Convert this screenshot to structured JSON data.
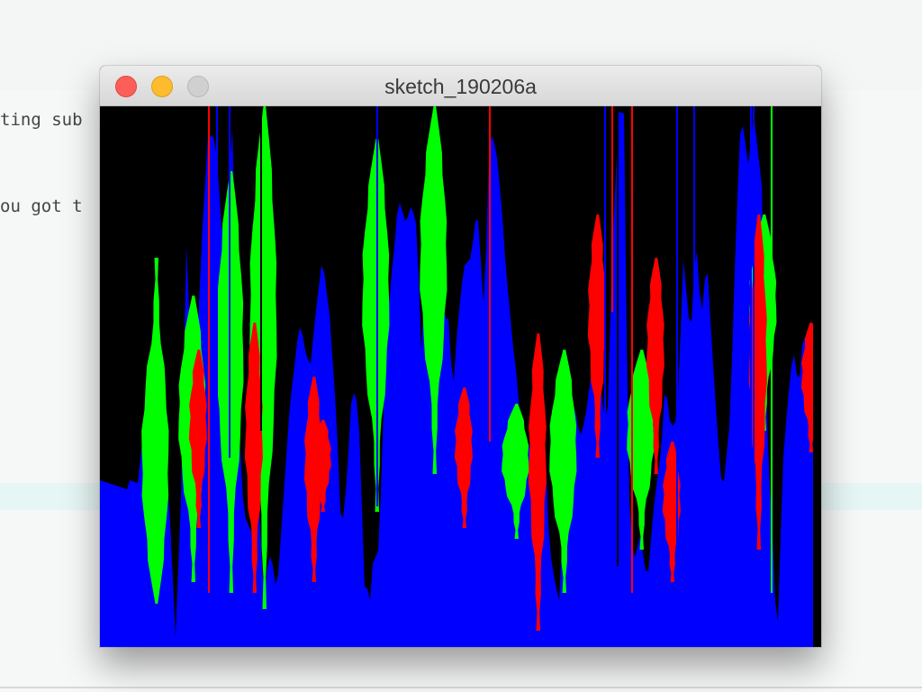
{
  "editor": {
    "lines": [
      {
        "text": "ting sub"
      },
      {
        "text": "ou got t"
      }
    ]
  },
  "window": {
    "title": "sketch_190206a",
    "buttons": {
      "close": "close-icon",
      "minimize": "minimize-icon",
      "zoom": "zoom-icon"
    }
  },
  "sketch": {
    "background": "#000000",
    "colors": {
      "blue": "#0000ff",
      "green": "#00ff00",
      "red": "#ff0000"
    },
    "segments": [
      [
        42,
        70,
        0
      ],
      [
        56,
        48,
        0
      ],
      [
        63,
        88,
        1
      ],
      [
        67,
        75,
        1
      ],
      [
        72,
        72,
        0
      ],
      [
        76,
        70,
        0
      ],
      [
        84,
        98,
        0
      ],
      [
        90,
        72,
        0
      ],
      [
        96,
        25,
        1
      ],
      [
        104,
        62,
        1
      ],
      [
        107,
        48,
        2
      ],
      [
        114,
        22,
        0
      ],
      [
        120,
        5,
        1
      ],
      [
        128,
        5,
        1
      ],
      [
        136,
        26,
        1
      ],
      [
        142,
        16,
        1
      ],
      [
        148,
        2,
        0
      ],
      [
        153,
        55,
        1
      ],
      [
        159,
        72,
        2
      ],
      [
        164,
        78,
        0
      ],
      [
        170,
        80,
        0
      ],
      [
        177,
        75,
        2
      ],
      [
        182,
        92,
        2
      ],
      [
        186,
        85,
        0
      ],
      [
        190,
        82,
        0
      ],
      [
        197,
        90,
        0
      ],
      [
        205,
        70,
        1
      ],
      [
        211,
        55,
        1
      ],
      [
        216,
        48,
        2
      ],
      [
        221,
        40,
        0
      ],
      [
        226,
        42,
        0
      ],
      [
        233,
        50,
        0
      ],
      [
        240,
        38,
        2
      ],
      [
        247,
        28,
        0
      ],
      [
        255,
        38,
        0
      ],
      [
        262,
        55,
        0
      ],
      [
        268,
        80,
        0
      ],
      [
        274,
        70,
        2
      ],
      [
        280,
        52,
        0
      ],
      [
        287,
        55,
        0
      ],
      [
        294,
        88,
        0
      ],
      [
        300,
        92,
        0
      ],
      [
        303,
        85,
        2
      ],
      [
        310,
        82,
        0
      ],
      [
        317,
        45,
        0
      ],
      [
        325,
        28,
        0
      ],
      [
        332,
        18,
        0
      ],
      [
        340,
        22,
        0
      ],
      [
        346,
        18,
        0
      ],
      [
        352,
        22,
        0
      ],
      [
        357,
        45,
        0
      ],
      [
        362,
        28,
        0
      ],
      [
        370,
        4,
        1
      ],
      [
        376,
        2,
        1
      ],
      [
        382,
        42,
        0
      ],
      [
        386,
        36,
        0
      ],
      [
        392,
        52,
        1
      ],
      [
        398,
        40,
        0
      ],
      [
        404,
        30,
        0
      ],
      [
        412,
        28,
        0
      ],
      [
        419,
        18,
        2
      ],
      [
        427,
        38,
        0
      ],
      [
        433,
        5,
        0
      ],
      [
        440,
        8,
        0
      ],
      [
        446,
        18,
        0
      ],
      [
        451,
        30,
        0
      ],
      [
        458,
        42,
        2
      ],
      [
        465,
        55,
        0
      ],
      [
        471,
        68,
        0
      ],
      [
        480,
        60,
        0
      ],
      [
        487,
        52,
        0
      ],
      [
        493,
        58,
        2
      ],
      [
        499,
        82,
        0
      ],
      [
        505,
        88,
        0
      ],
      [
        511,
        92,
        0
      ],
      [
        516,
        65,
        0
      ],
      [
        521,
        62,
        0
      ],
      [
        526,
        55,
        2
      ],
      [
        533,
        62,
        0
      ],
      [
        539,
        58,
        0
      ],
      [
        545,
        50,
        0
      ],
      [
        551,
        45,
        2
      ],
      [
        557,
        52,
        0
      ],
      [
        563,
        62,
        0
      ],
      [
        569,
        28,
        0
      ],
      [
        576,
        1,
        0
      ],
      [
        582,
        1,
        0
      ],
      [
        587,
        70,
        0
      ],
      [
        593,
        85,
        0
      ],
      [
        600,
        80,
        2
      ],
      [
        608,
        88,
        0
      ],
      [
        616,
        72,
        2
      ],
      [
        622,
        65,
        0
      ],
      [
        628,
        52,
        0
      ],
      [
        634,
        60,
        2
      ],
      [
        641,
        58,
        0
      ],
      [
        648,
        28,
        0
      ],
      [
        656,
        42,
        0
      ],
      [
        662,
        25,
        0
      ],
      [
        668,
        40,
        0
      ],
      [
        674,
        28,
        0
      ],
      [
        680,
        45,
        0
      ],
      [
        686,
        60,
        0
      ],
      [
        692,
        72,
        0
      ],
      [
        700,
        58,
        0
      ],
      [
        706,
        25,
        0
      ],
      [
        712,
        1,
        0
      ],
      [
        720,
        10,
        0
      ],
      [
        726,
        2,
        2
      ],
      [
        735,
        15,
        0
      ],
      [
        742,
        65,
        0
      ],
      [
        748,
        82,
        0
      ],
      [
        752,
        100,
        0
      ],
      [
        758,
        68,
        0
      ],
      [
        764,
        55,
        0
      ],
      [
        770,
        45,
        0
      ],
      [
        776,
        52,
        0
      ],
      [
        782,
        40,
        0
      ],
      [
        788,
        52,
        0
      ],
      [
        794,
        70,
        0
      ],
      [
        801,
        80,
        0
      ]
    ],
    "streaks": [
      [
        120,
        2,
        90
      ],
      [
        143,
        0,
        65
      ],
      [
        129,
        0,
        95
      ],
      [
        178,
        15,
        60
      ],
      [
        432,
        2,
        62
      ],
      [
        560,
        0,
        60
      ],
      [
        568,
        2,
        38
      ],
      [
        574,
        5,
        85
      ],
      [
        590,
        2,
        90
      ],
      [
        640,
        0,
        92
      ],
      [
        659,
        0,
        50
      ],
      [
        722,
        0,
        68
      ],
      [
        725,
        0,
        75
      ],
      [
        745,
        1,
        90
      ],
      [
        307,
        0,
        74
      ]
    ],
    "green_peaks": [
      [
        63,
        92,
        28
      ],
      [
        104,
        35,
        88
      ],
      [
        146,
        12,
        90
      ],
      [
        183,
        0,
        93
      ],
      [
        308,
        6,
        75
      ],
      [
        372,
        0,
        68
      ],
      [
        463,
        55,
        80
      ],
      [
        516,
        45,
        90
      ],
      [
        602,
        45,
        82
      ],
      [
        738,
        20,
        60
      ]
    ],
    "red_peaks": [
      [
        110,
        45,
        78
      ],
      [
        172,
        40,
        90
      ],
      [
        238,
        50,
        88
      ],
      [
        248,
        58,
        75
      ],
      [
        405,
        52,
        78
      ],
      [
        487,
        42,
        97
      ],
      [
        553,
        20,
        65
      ],
      [
        618,
        28,
        68
      ],
      [
        636,
        62,
        88
      ],
      [
        732,
        20,
        82
      ],
      [
        790,
        40,
        64
      ]
    ]
  }
}
